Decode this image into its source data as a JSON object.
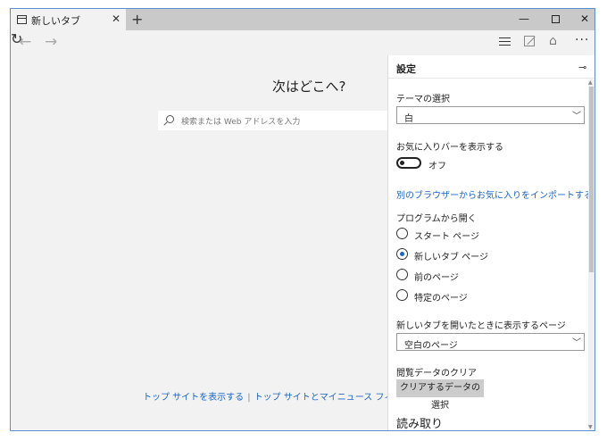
{
  "tab": {
    "title": "新しいタブ",
    "close": "✕"
  },
  "titlebar": {
    "new_tab": "+",
    "minimize": "—",
    "close": "✕"
  },
  "nav": {
    "back": "←",
    "forward": "→",
    "refresh": "↻",
    "share": "⌂",
    "more": "···"
  },
  "page": {
    "heading": "次はどこへ?",
    "search_placeholder": "検索または Web アドレスを入力",
    "footer": {
      "link1": "トップ サイトを表示する",
      "separator": "|",
      "link2": "トップ サイトとマイニュース フィードを表示"
    }
  },
  "settings": {
    "title": "設定",
    "pin": "⊸",
    "theme_label": "テーマの選択",
    "theme_value": "白",
    "favbar_label": "お気に入りバーを表示する",
    "favbar_state": "オフ",
    "import_link": "別のブラウザーからお気に入りをインポートする",
    "open_with_label": "プログラムから開く",
    "open_with_options": [
      {
        "label": "スタート ページ",
        "checked": false
      },
      {
        "label": "新しいタブ ページ",
        "checked": true
      },
      {
        "label": "前のページ",
        "checked": false
      },
      {
        "label": "特定のページ",
        "checked": false
      }
    ],
    "newtab_label": "新しいタブを開いたときに表示するページ",
    "newtab_value": "空白のページ",
    "clear_label": "閲覧データのクリア",
    "clear_button": "クリアするデータの選択",
    "reading_section": "読み取り"
  },
  "colors": {
    "accent": "#1a66c8",
    "border": "#5a8fd6"
  }
}
